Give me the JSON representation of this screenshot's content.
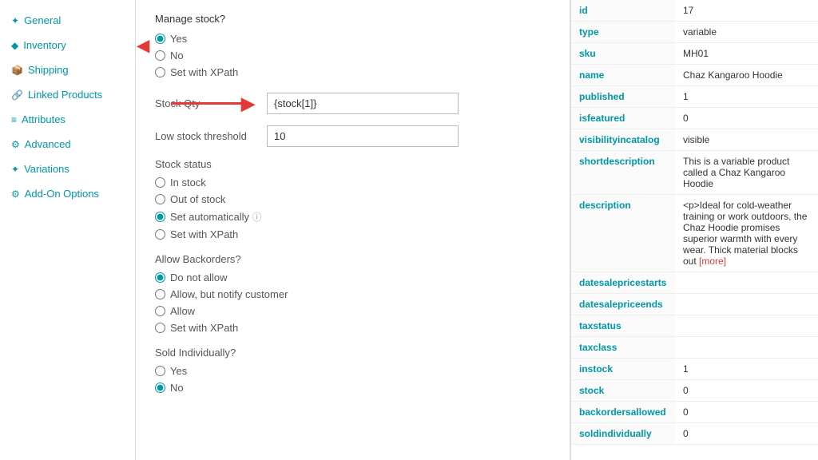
{
  "sidebar": {
    "items": [
      {
        "id": "general",
        "label": "General",
        "icon": "✦"
      },
      {
        "id": "inventory",
        "label": "Inventory",
        "icon": "◆"
      },
      {
        "id": "shipping",
        "label": "Shipping",
        "icon": "📦"
      },
      {
        "id": "linked-products",
        "label": "Linked Products",
        "icon": "🔗"
      },
      {
        "id": "attributes",
        "label": "Attributes",
        "icon": "≡"
      },
      {
        "id": "advanced",
        "label": "Advanced",
        "icon": "⚙"
      },
      {
        "id": "variations",
        "label": "Variations",
        "icon": "✦"
      },
      {
        "id": "add-on-options",
        "label": "Add-On Options",
        "icon": "⚙"
      }
    ]
  },
  "main": {
    "manage_stock_label": "Manage stock?",
    "manage_stock_options": [
      "Yes",
      "No",
      "Set with XPath"
    ],
    "manage_stock_selected": "Yes",
    "stock_qty_label": "Stock Qty",
    "stock_qty_value": "{stock[1]}",
    "low_stock_label": "Low stock threshold",
    "low_stock_value": "10",
    "stock_status_label": "Stock status",
    "stock_status_options": [
      "In stock",
      "Out of stock",
      "Set automatically",
      "Set with XPath"
    ],
    "stock_status_selected": "Set automatically",
    "backorders_label": "Allow Backorders?",
    "backorders_options": [
      "Do not allow",
      "Allow, but notify customer",
      "Allow",
      "Set with XPath"
    ],
    "backorders_selected": "Do not allow",
    "sold_individually_label": "Sold Individually?",
    "sold_individually_options": [
      "Yes",
      "No"
    ],
    "sold_individually_selected": "No"
  },
  "panel": {
    "rows": [
      {
        "key": "id",
        "value": "17"
      },
      {
        "key": "type",
        "value": "variable"
      },
      {
        "key": "sku",
        "value": "MH01"
      },
      {
        "key": "name",
        "value": "Chaz Kangaroo Hoodie"
      },
      {
        "key": "published",
        "value": "1"
      },
      {
        "key": "isfeatured",
        "value": "0"
      },
      {
        "key": "visibilityincatalog",
        "value": "visible"
      },
      {
        "key": "shortdescription",
        "value": "This is a variable product called a Chaz Kangaroo Hoodie"
      },
      {
        "key": "description",
        "value": "<p>Ideal for cold-weather training or work outdoors, the Chaz Hoodie promises superior warmth with every wear. Thick material blocks out"
      },
      {
        "key": "datesalepricestarts",
        "value": ""
      },
      {
        "key": "datesalepriceends",
        "value": ""
      },
      {
        "key": "taxstatus",
        "value": ""
      },
      {
        "key": "taxclass",
        "value": ""
      },
      {
        "key": "instock",
        "value": "1"
      },
      {
        "key": "stock",
        "value": "0"
      },
      {
        "key": "backordersallowed",
        "value": "0"
      },
      {
        "key": "soldindividually",
        "value": "0"
      }
    ]
  }
}
